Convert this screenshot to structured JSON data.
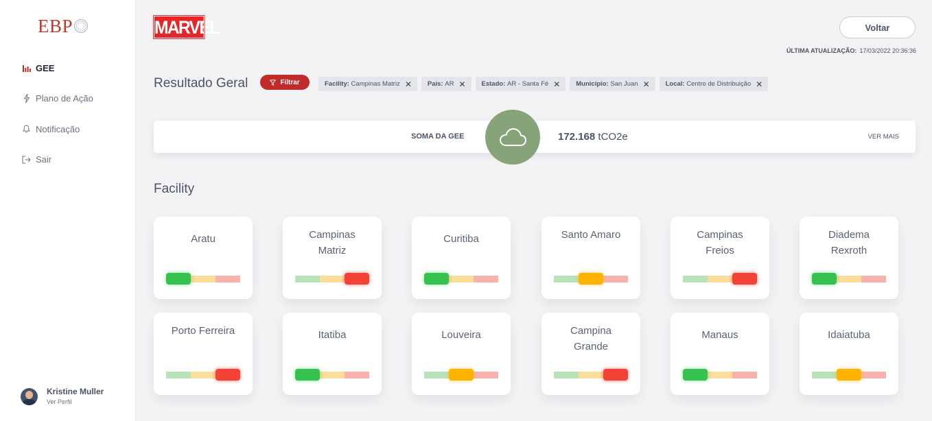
{
  "sidebar": {
    "logo_text": "EBP",
    "items": [
      {
        "label": "GEE",
        "icon": "bar-chart-icon",
        "active": true
      },
      {
        "label": "Plano de Ação",
        "icon": "bolt-icon",
        "active": false
      },
      {
        "label": "Notificação",
        "icon": "bell-icon",
        "active": false
      },
      {
        "label": "Sair",
        "icon": "logout-icon",
        "active": false
      }
    ],
    "profile": {
      "name": "Kristine Muller",
      "link": "Ver Perfil"
    }
  },
  "header": {
    "brand": "MARVEL",
    "back_label": "Voltar",
    "updated_label": "ÚLTIMA ATUALIZAÇÃO:",
    "updated_value": "17/03/2022 20:36:36"
  },
  "results": {
    "title": "Resultado Geral",
    "filter_label": "Filtrar",
    "chips": [
      {
        "key": "Facility:",
        "value": "Campinas Matriz"
      },
      {
        "key": "País:",
        "value": "AR"
      },
      {
        "key": "Estado:",
        "value": "AR - Santa Fé"
      },
      {
        "key": "Município:",
        "value": "San Juan"
      },
      {
        "key": "Local:",
        "value": "Centro de Distribuição"
      }
    ]
  },
  "summary": {
    "label": "SOMA DA GEE",
    "value": "172.168",
    "unit": "tCO2e",
    "see_more": "VER MAIS",
    "icon": "cloud-icon"
  },
  "facility": {
    "title": "Facility",
    "cards": [
      {
        "name": "Aratu",
        "status": "green"
      },
      {
        "name": "Campinas Matriz",
        "status": "red"
      },
      {
        "name": "Curitiba",
        "status": "green"
      },
      {
        "name": "Santo Amaro",
        "status": "yellow"
      },
      {
        "name": "Campinas Freios",
        "status": "red"
      },
      {
        "name": "Diadema Rexroth",
        "status": "green"
      },
      {
        "name": "Porto Ferreira",
        "status": "red"
      },
      {
        "name": "Itatiba",
        "status": "green"
      },
      {
        "name": "Louveira",
        "status": "yellow"
      },
      {
        "name": "Campina Grande",
        "status": "red"
      },
      {
        "name": "Manaus",
        "status": "green"
      },
      {
        "name": "Idaiatuba",
        "status": "yellow"
      }
    ]
  },
  "colors": {
    "accent_red": "#c32a2a",
    "cloud_green": "#86a379",
    "status_green": "#35c24f",
    "status_yellow": "#ffb300",
    "status_red": "#f44336"
  }
}
